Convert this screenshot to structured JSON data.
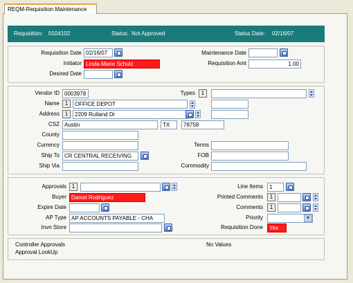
{
  "window": {
    "tab_label": "REQM-Requisition Maintenance"
  },
  "header": {
    "requisition_label": "Requisition:",
    "requisition_value": "0104102",
    "status_label": "Status:",
    "status_value": "Not Approved",
    "status_date_label": "Status Date:",
    "status_date_value": "02/16/07"
  },
  "section1": {
    "requisition_date_label": "Requisition Date",
    "requisition_date_value": "02/16/07",
    "initiator_label": "Initiator",
    "initiator_value": "Linda-Marie Schulz",
    "desired_date_label": "Desired Date",
    "desired_date_value": "",
    "maintenance_date_label": "Maintenance Date",
    "maintenance_date_value": "",
    "requisition_amt_label": "Requisition Amt",
    "requisition_amt_value": "1.00"
  },
  "section2": {
    "vendor_id_label": "Vendor ID",
    "vendor_id_value": "0003978",
    "types_label": "Types",
    "types_count": "1",
    "types_value": "",
    "name_label": "Name",
    "name_count": "1",
    "name_value": "OFFICE DEPOT",
    "address_label": "Address",
    "address_count": "1",
    "address_value": "2209 Rutland Dr",
    "csz_label": "CSZ",
    "city_value": "Austin",
    "state_value": "TX",
    "zip_value": "78758",
    "county_label": "County",
    "county_value": "",
    "currency_label": "Currency",
    "currency_value": "",
    "ship_to_label": "Ship To",
    "ship_to_value": "CR CENTRAL RECEIVING",
    "ship_via_label": "Ship Via",
    "ship_via_value": "",
    "terms_label": "Terms",
    "terms_value": "",
    "fob_label": "FOB",
    "fob_value": "",
    "commodity_label": "Commodity",
    "commodity_value": ""
  },
  "section3": {
    "approvals_label": "Approvals",
    "approvals_count": "1",
    "approvals_value": "",
    "buyer_label": "Buyer",
    "buyer_value": "Daniel Rodriguez",
    "expire_date_label": "Expire Date",
    "expire_date_value": "",
    "ap_type_label": "AP Type",
    "ap_type_value": "AP ACCOUNTS PAYABLE - CHA",
    "invn_store_label": "Invn Store",
    "invn_store_value": "",
    "line_items_label": "Line Items",
    "line_items_value": "1",
    "printed_comments_label": "Printed Comments",
    "printed_comments_count": "1",
    "comments_label": "Comments",
    "comments_count": "1",
    "priority_label": "Priority",
    "priority_value": "",
    "requisition_done_label": "Requisition Done",
    "requisition_done_value": "Yes"
  },
  "footer": {
    "controller_approvals_label": "Controller Approvals",
    "approval_lookup_label": "Approval LookUp",
    "no_values_text": "No Values"
  },
  "colors": {
    "header_bg": "#1b7a7a",
    "required_field": "#ff1a1a",
    "window_bg": "#ece9d8"
  },
  "icons": [
    "calendar-icon",
    "lookup-icon",
    "spinner-icon",
    "dropdown-arrow-icon"
  ]
}
